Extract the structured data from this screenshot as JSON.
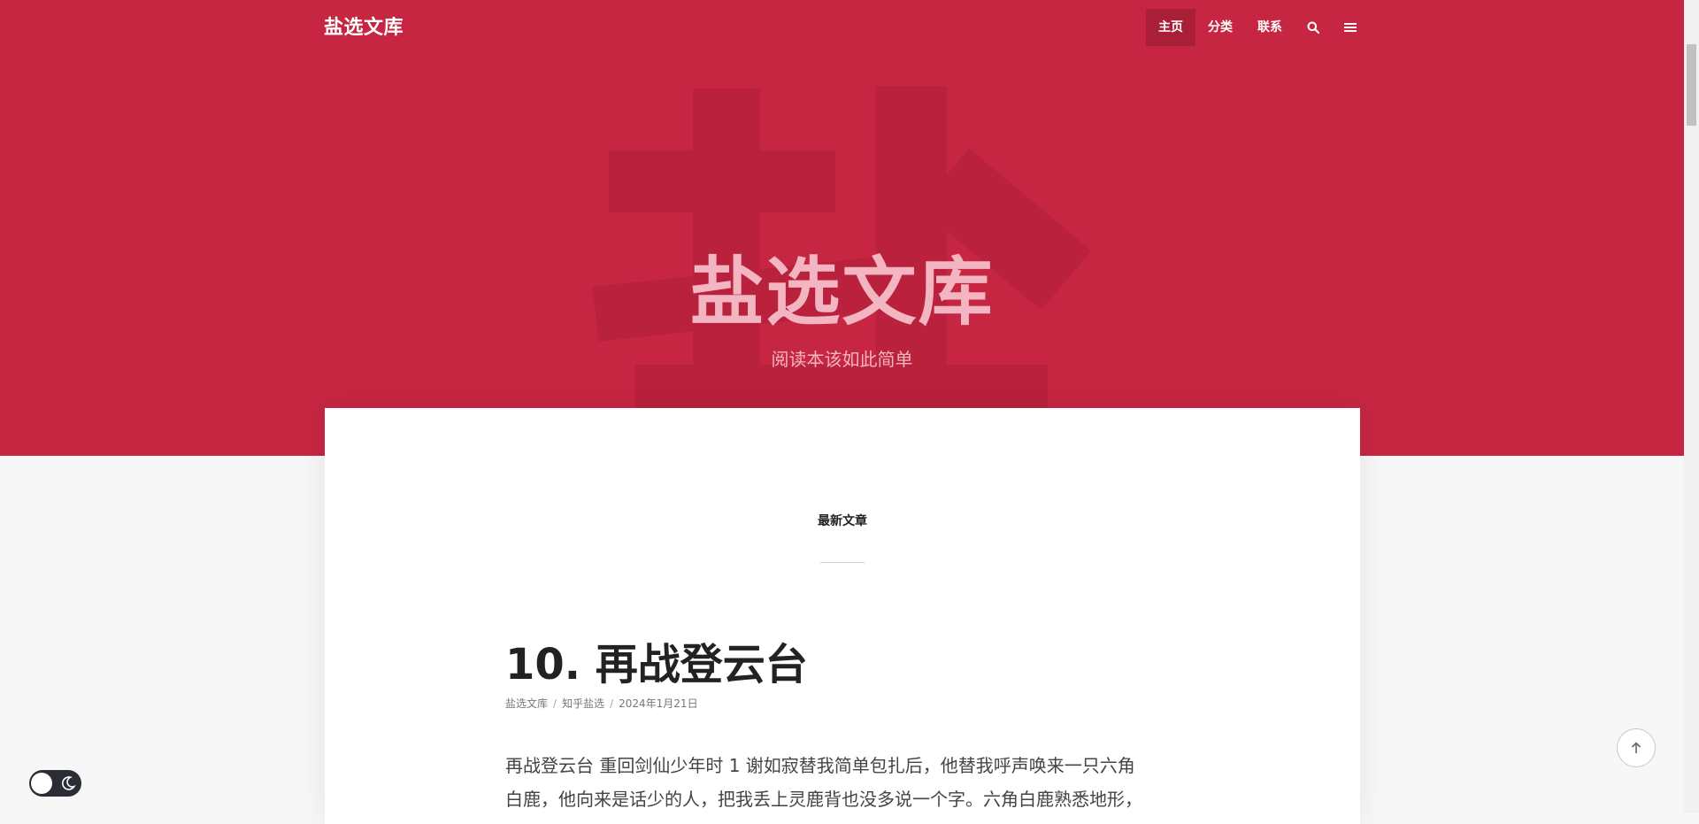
{
  "site": {
    "brand": "盐选文库",
    "hero_title": "盐选文库",
    "hero_subtitle": "阅读本该如此简单"
  },
  "nav": {
    "items": [
      {
        "label": "主页",
        "active": true
      },
      {
        "label": "分类",
        "active": false
      },
      {
        "label": "联系",
        "active": false
      }
    ],
    "search_icon": "search-icon",
    "menu_icon": "menu-icon"
  },
  "main": {
    "section_label": "最新文章",
    "post": {
      "title": "10. 再战登云台",
      "meta": [
        "盐选文库",
        "知乎盐选",
        "2024年1月21日"
      ],
      "excerpt_lines": [
        "再战登云台 重回剑仙少年时 1 谢如寂替我简单包扎后，他替我呼声唤来一只六角",
        "白鹿，他向来是话少的人，把我丢上灵鹿背也没多说一个字。六角白鹿熟悉地形，"
      ]
    }
  },
  "widgets": {
    "back_to_top_icon": "arrow-up-icon",
    "theme_toggle_icon": "moon-icon"
  },
  "colors": {
    "hero_bg": "#c62641",
    "hero_glyph": "#b9213c",
    "nav_active_bg": "#a81f37",
    "hero_text": "#f2b5c1"
  }
}
